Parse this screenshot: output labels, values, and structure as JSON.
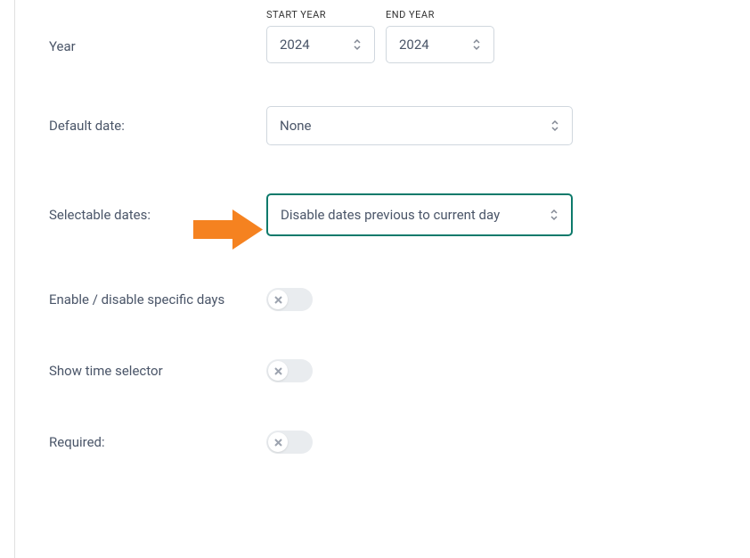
{
  "labels": {
    "year": "Year",
    "start_year": "START YEAR",
    "end_year": "END YEAR",
    "default_date": "Default date:",
    "selectable_dates": "Selectable dates:",
    "enable_disable_days": "Enable / disable specific days",
    "show_time_selector": "Show time selector",
    "required": "Required:"
  },
  "values": {
    "start_year": "2024",
    "end_year": "2024",
    "default_date": "None",
    "selectable_dates": "Disable dates previous to current day"
  }
}
